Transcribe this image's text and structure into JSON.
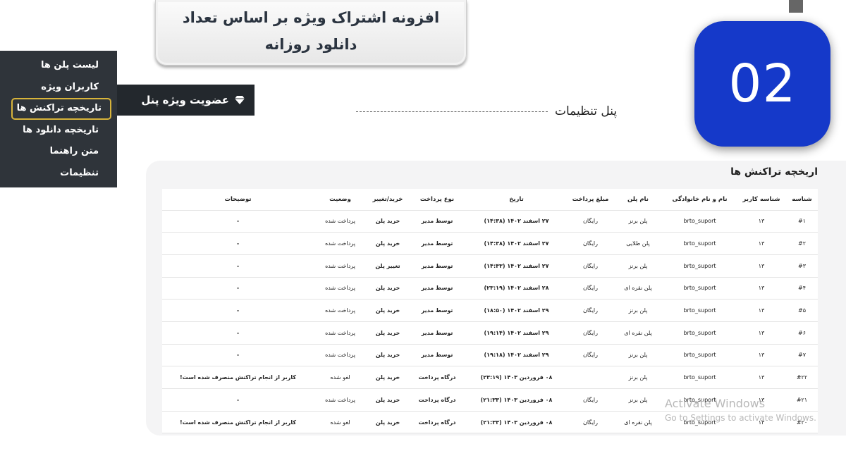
{
  "title_box": {
    "line1": "افزونه اشتراک ویژه بر اساس تعداد",
    "line2": "دانلود روزانه"
  },
  "badge": {
    "number": "02"
  },
  "panel_label": "پنل تنظیمات",
  "plugin_tab": {
    "label": "عضویت ویژه پنل",
    "icon": "diamond-icon"
  },
  "side_menu": {
    "items": [
      {
        "label": "لیست پلن ها"
      },
      {
        "label": "کاربران ویژه"
      },
      {
        "label": "تاریخچه تراکنش ها"
      },
      {
        "label": "تاریخچه دانلود ها"
      },
      {
        "label": "متن راهنما"
      },
      {
        "label": "تنظیمات"
      }
    ]
  },
  "table": {
    "title": "اریخچه تراکنش ها",
    "headers": [
      "شناسه",
      "شناسه کاربر",
      "نام و نام خانوادگی",
      "نام پلن",
      "مبلغ پرداخت",
      "تاریخ",
      "نوع پرداخت",
      "خرید/تغییر",
      "وضعیت",
      "توضیحات"
    ],
    "rows": [
      [
        "#۱",
        "۱۳",
        "brto_suport",
        "پلن برنز",
        "رایگان",
        "۲۷ اسفند ۱۴۰۲ (۱۴:۳۸)",
        "توسط مدیر",
        "خرید پلن",
        "پرداخت شده",
        "-"
      ],
      [
        "#۲",
        "۱۳",
        "brto_suport",
        "پلن طلایی",
        "رایگان",
        "۲۷ اسفند ۱۴۰۲ (۱۴:۳۸)",
        "توسط مدیر",
        "خرید پلن",
        "پرداخت شده",
        "-"
      ],
      [
        "#۳",
        "۱۳",
        "brto_suport",
        "پلن برنز",
        "رایگان",
        "۲۷ اسفند ۱۴۰۲ (۱۴:۴۳)",
        "توسط مدیر",
        "تغییر پلن",
        "پرداخت شده",
        "-"
      ],
      [
        "#۴",
        "۱۳",
        "brto_suport",
        "پلن نقره ای",
        "رایگان",
        "۲۸ اسفند ۱۴۰۲ (۲۳:۱۹)",
        "توسط مدیر",
        "خرید پلن",
        "پرداخت شده",
        "-"
      ],
      [
        "#۵",
        "۱۳",
        "brto_suport",
        "پلن برنز",
        "رایگان",
        "۲۹ اسفند ۱۴۰۲ (۱۸:۵۰)",
        "توسط مدیر",
        "خرید پلن",
        "پرداخت شده",
        "-"
      ],
      [
        "#۶",
        "۱۳",
        "brto_suport",
        "پلن نقره ای",
        "رایگان",
        "۲۹ اسفند ۱۴۰۲ (۱۹:۱۴)",
        "توسط مدیر",
        "خرید پلن",
        "پرداخت شده",
        "-"
      ],
      [
        "#۷",
        "۱۳",
        "brto_suport",
        "پلن برنز",
        "رایگان",
        "۲۹ اسفند ۱۴۰۲ (۱۹:۱۸)",
        "توسط مدیر",
        "خرید پلن",
        "پرداخت شده",
        "-"
      ],
      [
        "#۲۲",
        "۱۳",
        "brto_suport",
        "پلن برنز",
        "",
        "۰۸ فروردین ۱۴۰۳ (۲۳:۱۹)",
        "درگاه پرداخت",
        "خرید پلن",
        "لغو شده",
        "کاربر از انجام تراکنش منصرف شده است!"
      ],
      [
        "#۲۱",
        "۱۳",
        "brto_suport",
        "پلن برنز",
        "رایگان",
        "۰۸ فروردین ۱۴۰۳ (۲۱:۳۳)",
        "درگاه پرداخت",
        "خرید پلن",
        "پرداخت شده",
        "-"
      ],
      [
        "#۲۰",
        "۱۳",
        "brto_suport",
        "پلن نقره ای",
        "رایگان",
        "۰۸ فروردین ۱۴۰۳ (۲۱:۳۳)",
        "درگاه پرداخت",
        "خرید پلن",
        "لغو شده",
        "کاربر از انجام تراکنش منصرف شده است!"
      ]
    ]
  },
  "watermark": {
    "line1": "Activate Windows",
    "line2": "Go to Settings to activate Windows."
  },
  "colors": {
    "badge": "#1539c9",
    "menu_bg": "#2f343a",
    "active_border": "#d8b43a",
    "paid": "#2faa4f",
    "cancelled": "#e53935",
    "changed": "#1e5bd6"
  }
}
